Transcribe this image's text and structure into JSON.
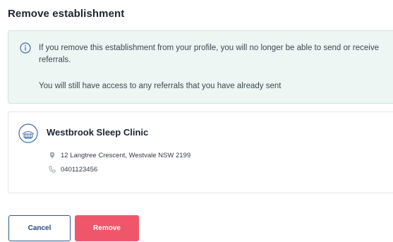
{
  "dialog": {
    "title": "Remove establishment"
  },
  "notice": {
    "icon": "info-circle-icon",
    "line1": "If you remove this establishment from your profile, you will no longer be able to send or receive referrals.",
    "line2": "You will still have access to any referrals that you have already sent"
  },
  "establishment": {
    "logo_icon": "sleep-clinic-logo-icon",
    "name": "Westbrook Sleep Clinic",
    "address": "12 Langtree Crescent, Westvale NSW 2199",
    "phone": "0401123456"
  },
  "actions": {
    "cancel_label": "Cancel",
    "remove_label": "Remove"
  },
  "colors": {
    "remove_button": "#f0566a",
    "cancel_border": "#2f5788",
    "notice_background": "#eef6f4",
    "accent_blue": "#3a6ea8"
  }
}
